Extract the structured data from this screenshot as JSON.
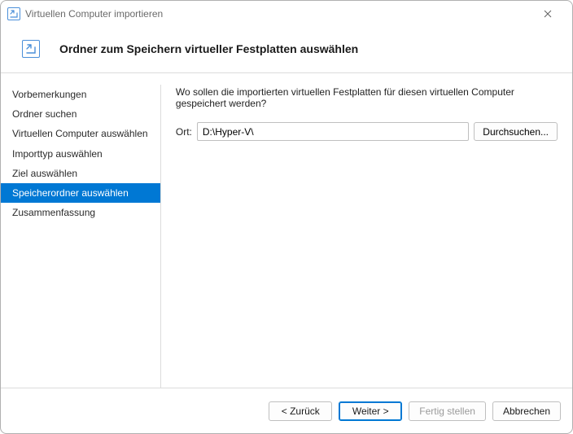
{
  "window": {
    "title": "Virtuellen Computer importieren"
  },
  "header": {
    "title": "Ordner zum Speichern virtueller Festplatten auswählen"
  },
  "sidebar": {
    "items": [
      {
        "label": "Vorbemerkungen"
      },
      {
        "label": "Ordner suchen"
      },
      {
        "label": "Virtuellen Computer auswählen"
      },
      {
        "label": "Importtyp auswählen"
      },
      {
        "label": "Ziel auswählen"
      },
      {
        "label": "Speicherordner auswählen"
      },
      {
        "label": "Zusammenfassung"
      }
    ],
    "selected_index": 5
  },
  "content": {
    "prompt": "Wo sollen die importierten virtuellen Festplatten für diesen virtuellen Computer gespeichert werden?",
    "location_label": "Ort:",
    "location_value": "D:\\Hyper-V\\",
    "browse_label": "Durchsuchen..."
  },
  "footer": {
    "back": "< Zurück",
    "next": "Weiter >",
    "finish": "Fertig stellen",
    "cancel": "Abbrechen"
  }
}
